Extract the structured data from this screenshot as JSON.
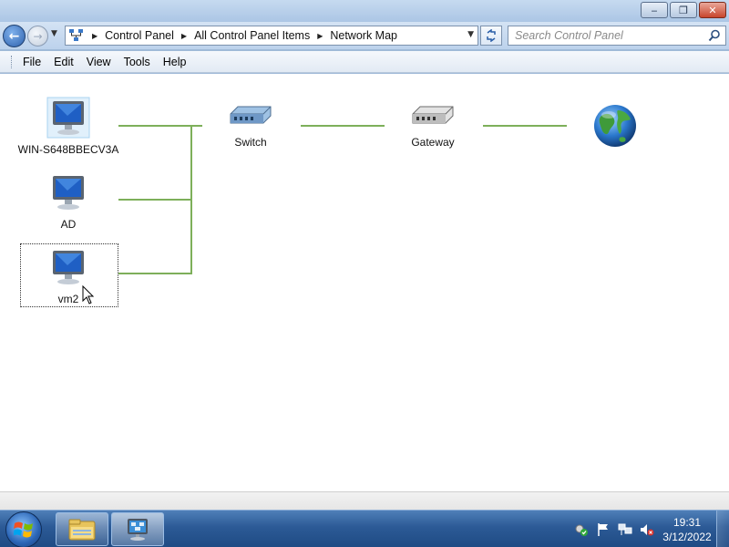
{
  "window": {
    "buttons": {
      "minimize": "‒",
      "maximize": "❐",
      "close": "✕"
    }
  },
  "address": {
    "breadcrumbs": [
      "Control Panel",
      "All Control Panel Items",
      "Network Map"
    ],
    "search_placeholder": "Search Control Panel"
  },
  "menu": [
    "File",
    "Edit",
    "View",
    "Tools",
    "Help"
  ],
  "network_map": {
    "computers": [
      {
        "label": "WIN-S648BBECV3A",
        "selected": false
      },
      {
        "label": "AD",
        "selected": false
      },
      {
        "label": "vm2",
        "focused": true
      }
    ],
    "switch_label": "Switch",
    "gateway_label": "Gateway",
    "internet_label": "",
    "link_color": "#7daf5a"
  },
  "taskbar": {
    "clock_time": "19:31",
    "clock_date": "3/12/2022",
    "pinned": [
      "windows-explorer",
      "network-and-sharing-center"
    ]
  }
}
